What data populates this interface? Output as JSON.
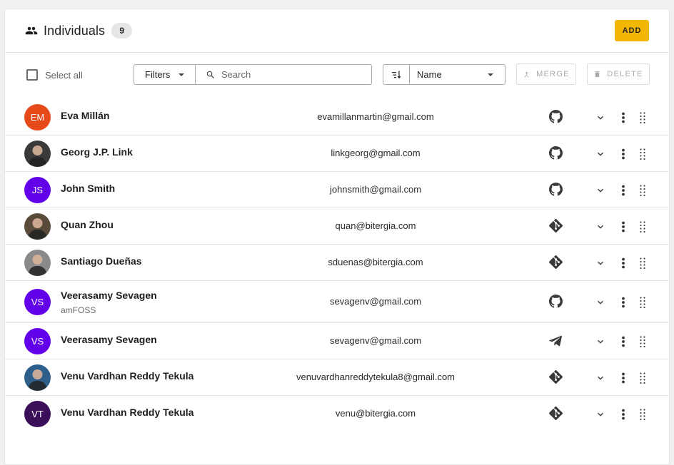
{
  "header": {
    "title": "Individuals",
    "count": "9",
    "add_label": "ADD",
    "icon": "people-icon",
    "accent": "#f2b705"
  },
  "toolbar": {
    "select_all_label": "Select all",
    "filters_label": "Filters",
    "search_placeholder": "Search",
    "sort_value": "Name",
    "merge_label": "MERGE",
    "delete_label": "DELETE"
  },
  "individuals": [
    {
      "name": "Eva Millán",
      "org": "",
      "email": "evamillanmartin@gmail.com",
      "initials": "EM",
      "avatar_color": "#e64a19",
      "avatar_type": "initials",
      "source": "github"
    },
    {
      "name": "Georg J.P. Link",
      "org": "",
      "email": "linkgeorg@gmail.com",
      "initials": "",
      "avatar_color": "#3a3a3a",
      "avatar_type": "photo",
      "source": "github"
    },
    {
      "name": "John Smith",
      "org": "",
      "email": "johnsmith@gmail.com",
      "initials": "JS",
      "avatar_color": "#6200ea",
      "avatar_type": "initials",
      "source": "github"
    },
    {
      "name": "Quan Zhou",
      "org": "",
      "email": "quan@bitergia.com",
      "initials": "",
      "avatar_color": "#5a4a3a",
      "avatar_type": "photo",
      "source": "git"
    },
    {
      "name": "Santiago Dueñas",
      "org": "",
      "email": "sduenas@bitergia.com",
      "initials": "",
      "avatar_color": "#8a8a8a",
      "avatar_type": "photo",
      "source": "git"
    },
    {
      "name": "Veerasamy Sevagen",
      "org": "amFOSS",
      "email": "sevagenv@gmail.com",
      "initials": "VS",
      "avatar_color": "#6200ea",
      "avatar_type": "initials",
      "source": "github"
    },
    {
      "name": "Veerasamy Sevagen",
      "org": "",
      "email": "sevagenv@gmail.com",
      "initials": "VS",
      "avatar_color": "#6200ea",
      "avatar_type": "initials",
      "source": "telegram"
    },
    {
      "name": "Venu Vardhan Reddy Tekula",
      "org": "",
      "email": "venuvardhanreddytekula8@gmail.com",
      "initials": "",
      "avatar_color": "#2d5f8a",
      "avatar_type": "photo",
      "source": "git"
    },
    {
      "name": "Venu Vardhan Reddy Tekula",
      "org": "",
      "email": "venu@bitergia.com",
      "initials": "VT",
      "avatar_color": "#3b0e5a",
      "avatar_type": "initials",
      "source": "git"
    }
  ]
}
